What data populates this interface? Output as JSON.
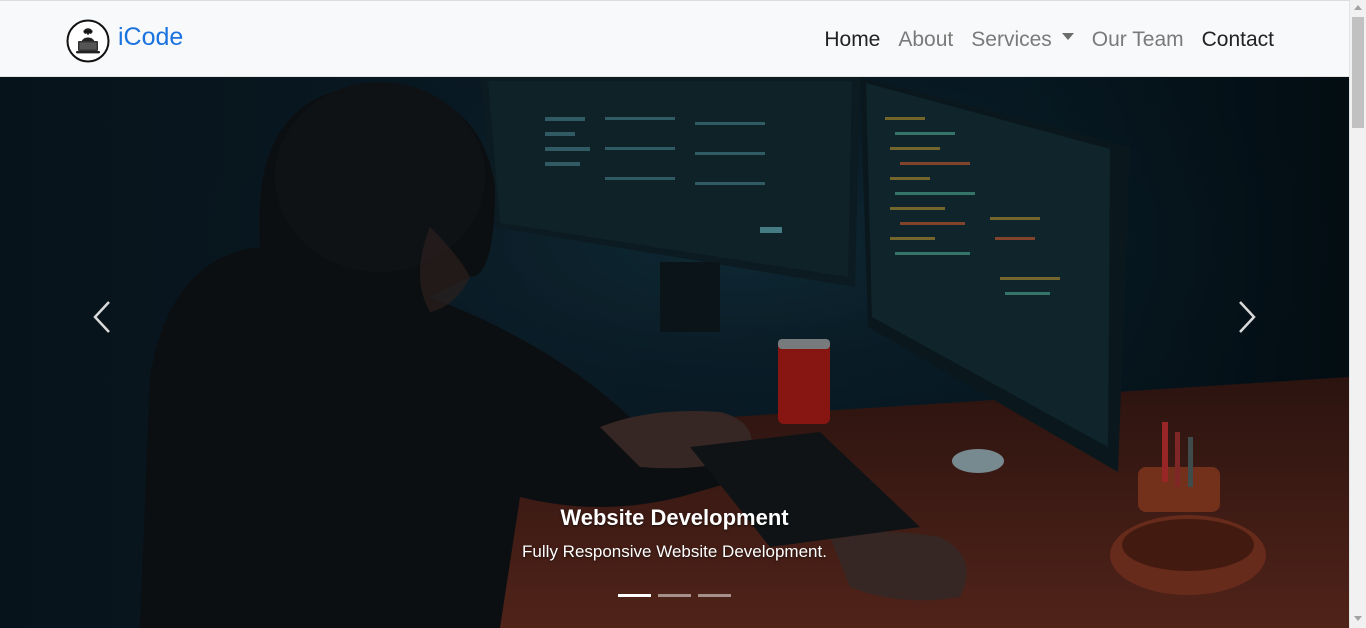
{
  "brand": {
    "name": "iCode",
    "logo_icon": "coder-at-laptop-logo-icon",
    "color": "#1b73e0"
  },
  "nav": {
    "items": [
      {
        "label": "Home",
        "active": true
      },
      {
        "label": "About",
        "active": false
      },
      {
        "label": "Services",
        "active": false,
        "dropdown": true
      },
      {
        "label": "Our Team",
        "active": false
      },
      {
        "label": "Contact",
        "active": false
      }
    ]
  },
  "carousel": {
    "prev_icon": "chevron-left-icon",
    "next_icon": "chevron-right-icon",
    "active_slide": {
      "title": "Website Development",
      "text": "Fully Responsive Website Development."
    },
    "indicators": [
      {
        "active": true
      },
      {
        "active": false
      },
      {
        "active": false
      }
    ]
  },
  "colors": {
    "navbar_bg": "#f8f9fa",
    "nav_active": "#222222",
    "nav_inactive": "#7a7a7a"
  }
}
